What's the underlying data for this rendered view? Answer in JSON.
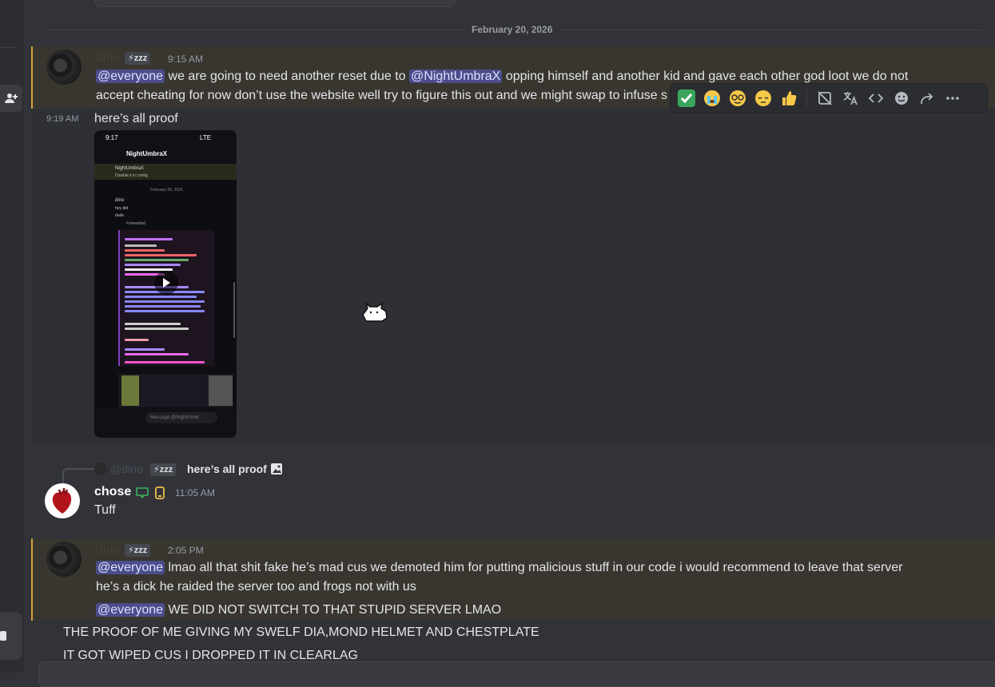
{
  "date_divider": "February 20, 2026",
  "messages": [
    {
      "author": "dino",
      "tag": "zzz",
      "time": "9:15 AM",
      "line1_mention": "@everyone",
      "line1_rest": "we are going to need another reset due to",
      "line1_mention2": "@NightUmbraX",
      "line1_rest2": "opping himself and another kid and gave each other god loot we do not",
      "line2": "accept cheating for now don’t use the website well try to figure this out and we might swap to infuse s"
    },
    {
      "time": "9:19 AM",
      "text": "here’s all proof",
      "video": {
        "time": "9:17",
        "status": "LTE",
        "contact": "NightUmbraX",
        "pinned_name": "NightUmbraX",
        "pinned_text": "Disable it in config.",
        "date": "February 20, 2026",
        "author": "dino",
        "line_hey": "hey did",
        "line_dude": "dude",
        "forwarded": "Forwarded",
        "message_placeholder": "Message @NightUmbr"
      }
    },
    {
      "reply_author": "@dino",
      "reply_tag": "zzz",
      "reply_text": "here’s all proof",
      "author": "chose",
      "time": "11:05 AM",
      "text": "Tuff"
    },
    {
      "author": "dino",
      "tag": "zzz",
      "time": "2:05 PM",
      "line1_mention": "@everyone",
      "line1_rest": "lmao all that shit fake he’s mad cus we demoted him for putting malicious stuff in our code i would recommend to leave that server",
      "line2": "he’s a dick he raided the server too and frogs not with us",
      "line3_mention": "@everyone",
      "line3_rest": "WE DID NOT SWITCH TO THAT STUPID SERVER LMAO",
      "line4": "THE PROOF OF ME GIVING MY SWELF DIA,MOND HELMET AND CHESTPLATE",
      "line5": "IT GOT WIPED CUS I DROPPED IT IN CLEARLAG"
    }
  ],
  "toolbar_icons": [
    "check-mark-emoji",
    "crying-emoji",
    "nerd-emoji",
    "relieved-emoji",
    "thumbs-up-emoji",
    "remove-embed-icon",
    "translate-icon",
    "code-icon",
    "add-reaction-icon",
    "forward-icon",
    "more-icon"
  ],
  "colors": {
    "background": "#323339",
    "mention_highlight": "#393630",
    "mention_border": "#d4a13b",
    "mention_pill": "#4b4d8c"
  }
}
